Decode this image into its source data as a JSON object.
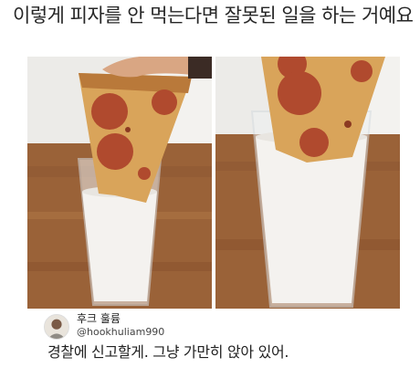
{
  "post": {
    "title": "이렇게 피자를 안 먹는다면 잘못된 일을 하는 거예요"
  },
  "images": [
    {
      "description_icon": "pizza-in-milk-photo-1"
    },
    {
      "description_icon": "pizza-in-milk-photo-2"
    }
  ],
  "reply": {
    "display_name": "후크 훌륨",
    "handle": "@hookhuliam990",
    "text": "경찰에 신고할게. 그냥 가만히 앉아 있어."
  },
  "colors": {
    "wood": "#a26a3f",
    "wall": "#e8e8e6",
    "milk": "#f4f2ef",
    "crust": "#d9a45a",
    "pepperoni": "#b04a2e"
  }
}
